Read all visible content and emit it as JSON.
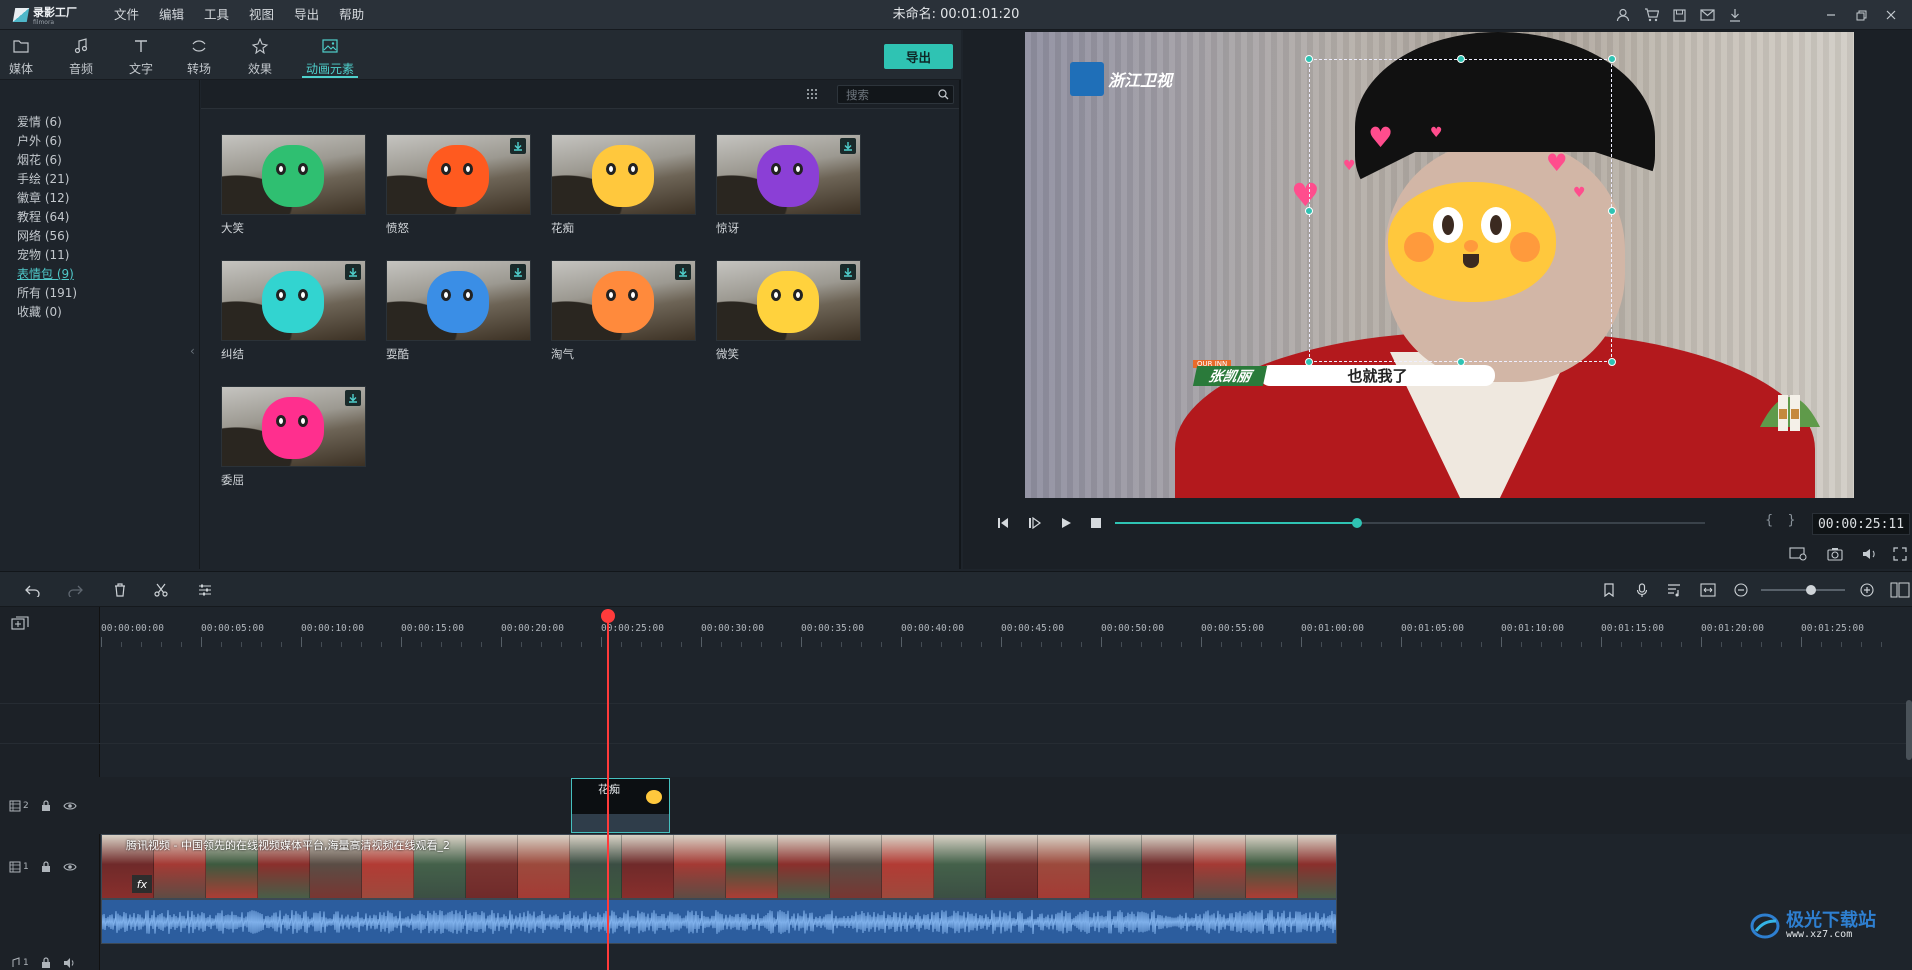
{
  "app": {
    "logo_name": "录影工厂",
    "logo_sub": "filmora",
    "document_title": "未命名: 00:01:01:20"
  },
  "menu": [
    "文件",
    "编辑",
    "工具",
    "视图",
    "导出",
    "帮助"
  ],
  "title_icons": [
    "user-icon",
    "cart-icon",
    "save-icon",
    "mail-icon",
    "download-icon"
  ],
  "window_controls": [
    "minimize-icon",
    "restore-icon",
    "close-icon"
  ],
  "library": {
    "tabs": [
      {
        "label": "媒体",
        "icon": "folder-icon"
      },
      {
        "label": "音频",
        "icon": "music-icon"
      },
      {
        "label": "文字",
        "icon": "text-icon"
      },
      {
        "label": "转场",
        "icon": "transition-icon"
      },
      {
        "label": "效果",
        "icon": "effects-icon"
      },
      {
        "label": "动画元素",
        "icon": "image-icon",
        "active": true
      }
    ],
    "export_label": "导出",
    "categories": [
      "爱情 (6)",
      "户外 (6)",
      "烟花 (6)",
      "手绘 (21)",
      "徽章 (12)",
      "教程 (64)",
      "网络 (56)",
      "宠物 (11)",
      "表情包 (9)",
      "所有 (191)",
      "收藏 (0)"
    ],
    "active_category": "表情包 (9)",
    "search_placeholder": "搜索",
    "items": [
      {
        "name": "大笑",
        "color": "#2fbf71",
        "download": false
      },
      {
        "name": "愤怒",
        "color": "#ff5a1f",
        "download": true
      },
      {
        "name": "花痴",
        "color": "#ffc83d",
        "download": false
      },
      {
        "name": "惊讶",
        "color": "#8b3fd6",
        "download": true
      },
      {
        "name": "纠结",
        "color": "#32d4d0",
        "download": true
      },
      {
        "name": "耍酷",
        "color": "#3a8ee6",
        "download": true
      },
      {
        "name": "淘气",
        "color": "#ff8a3c",
        "download": true
      },
      {
        "name": "微笑",
        "color": "#ffd23d",
        "download": true
      },
      {
        "name": "委屈",
        "color": "#ff2f8e",
        "download": true
      }
    ]
  },
  "preview": {
    "channel_logo": "浙江卫视",
    "lower_third_tag": "OUR INN",
    "person_name": "张凯丽",
    "caption": "也就我了",
    "timecode": "00:00:25:11",
    "progress": 0.41,
    "bracket_marks": "{ }"
  },
  "timeline": {
    "ruler_labels": [
      "00:00:00:00",
      "00:00:05:00",
      "00:00:10:00",
      "00:00:15:00",
      "00:00:20:00",
      "00:00:25:00",
      "00:00:30:00",
      "00:00:35:00",
      "00:00:40:00",
      "00:00:45:00",
      "00:00:50:00",
      "00:00:55:00",
      "00:01:00:00",
      "00:01:05:00",
      "00:01:10:00",
      "00:01:15:00",
      "00:01:20:00",
      "00:01:25:00"
    ],
    "tracks": [
      {
        "number": "2",
        "type": "video"
      },
      {
        "number": "1",
        "type": "video"
      },
      {
        "number": "1",
        "type": "audio"
      }
    ],
    "emoji_clip_label": "花痴",
    "video_clip_title": "腾讯视频 - 中国领先的在线视频媒体平台,海量高清视频在线观看_2",
    "fx_label": "fx",
    "zoom_level": 0.6
  },
  "watermark": {
    "line1": "极光下载站",
    "line2": "www.xz7.com"
  }
}
